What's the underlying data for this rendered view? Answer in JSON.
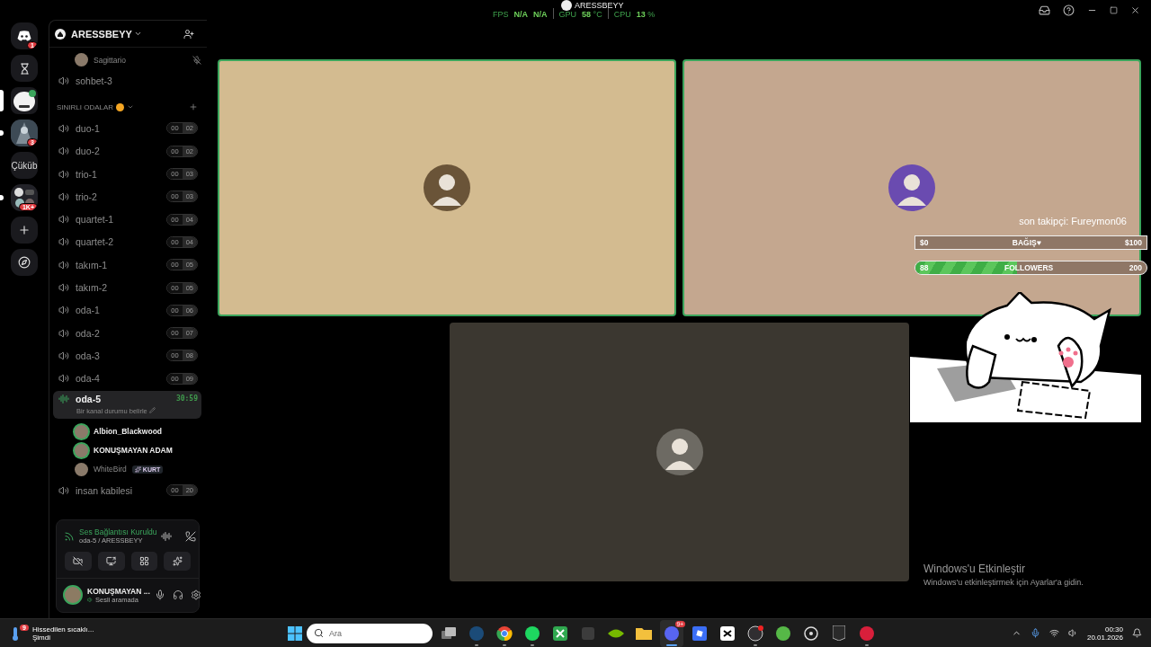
{
  "top_overlay": {
    "user": "ARESSBEYY",
    "fps_label": "FPS",
    "fps_value": "N/A",
    "fps_value_2": "N/A",
    "gpu_label": "GPU",
    "gpu_value": "58",
    "gpu_unit": "°C",
    "cpu_label": "CPU",
    "cpu_value": "13",
    "cpu_unit": "%"
  },
  "servers": [
    {
      "kind": "discord",
      "badge": "1",
      "selected": false,
      "unread": false
    },
    {
      "kind": "hourglass",
      "selected": false,
      "unread": false
    },
    {
      "kind": "mascot",
      "selected": true,
      "unread": false
    },
    {
      "kind": "game",
      "badge": "3",
      "selected": false,
      "unread": true
    },
    {
      "kind": "text",
      "label": "Çüküb",
      "selected": false,
      "unread": false
    },
    {
      "kind": "folder",
      "badge": "1K+",
      "selected": false,
      "unread": true
    },
    {
      "kind": "add",
      "selected": false,
      "unread": false
    },
    {
      "kind": "explore",
      "selected": false,
      "unread": false
    }
  ],
  "server_header": {
    "name": "ARESSBEYY"
  },
  "channel_list": [
    {
      "kind": "member",
      "name": "Sagittario",
      "speaking": false,
      "muted_icon": true
    },
    {
      "kind": "channel",
      "name": "sohbet-3",
      "selected": false
    },
    {
      "kind": "category",
      "name": "SINIRLI ODALAR"
    },
    {
      "kind": "channel",
      "name": "duo-1",
      "users": "00",
      "limit": "02",
      "selected": false
    },
    {
      "kind": "channel",
      "name": "duo-2",
      "users": "00",
      "limit": "02",
      "selected": false
    },
    {
      "kind": "channel",
      "name": "trio-1",
      "users": "00",
      "limit": "03",
      "selected": false
    },
    {
      "kind": "channel",
      "name": "trio-2",
      "users": "00",
      "limit": "03",
      "selected": false
    },
    {
      "kind": "channel",
      "name": "quartet-1",
      "users": "00",
      "limit": "04",
      "selected": false
    },
    {
      "kind": "channel",
      "name": "quartet-2",
      "users": "00",
      "limit": "04",
      "selected": false
    },
    {
      "kind": "channel",
      "name": "takım-1",
      "users": "00",
      "limit": "05",
      "selected": false
    },
    {
      "kind": "channel",
      "name": "takım-2",
      "users": "00",
      "limit": "05",
      "selected": false
    },
    {
      "kind": "channel",
      "name": "oda-1",
      "users": "00",
      "limit": "06",
      "selected": false
    },
    {
      "kind": "channel",
      "name": "oda-2",
      "users": "00",
      "limit": "07",
      "selected": false
    },
    {
      "kind": "channel",
      "name": "oda-3",
      "users": "00",
      "limit": "08",
      "selected": false
    },
    {
      "kind": "channel",
      "name": "oda-4",
      "users": "00",
      "limit": "09",
      "selected": false
    },
    {
      "kind": "channel",
      "name": "oda-5",
      "timer": "30:59",
      "status": "Bir kanal durumu belirle",
      "selected": true
    },
    {
      "kind": "member",
      "name": "Albion_Blackwood",
      "speaking": true
    },
    {
      "kind": "member",
      "name": "KONUŞMAYAN ADAM",
      "speaking": true
    },
    {
      "kind": "member",
      "name": "WhiteBird",
      "speaking": false,
      "tag": "KURT"
    },
    {
      "kind": "channel",
      "name": "insan kabilesi",
      "users": "00",
      "limit": "20",
      "selected": false
    }
  ],
  "voice_panel": {
    "status": "Ses Bağlantısı Kuruldu",
    "location": "oda-5 / ARESSBEYY"
  },
  "user_panel": {
    "name": "KONUŞMAYAN ...",
    "status": "Sesli aramada"
  },
  "tiles": [
    {
      "speaking": true,
      "color": "#d3bb90"
    },
    {
      "speaking": true,
      "color": "#c4a78f"
    },
    {
      "speaking": false,
      "color": "#3b3730"
    }
  ],
  "stream_overlay": {
    "last_follower": "son takipçi: Fureymon06",
    "donation": {
      "min": "$0",
      "label": "BAĞIŞ♥",
      "max": "$100",
      "level": 0
    },
    "followers": {
      "current": "88",
      "label": "FOLLOWERS",
      "goal": "200",
      "level": 0.44
    }
  },
  "activation": {
    "title": "Windows'u Etkinleştir",
    "text": "Windows'u etkinleştirmek için Ayarlar'a gidin."
  },
  "taskbar": {
    "weather": {
      "badge": "9",
      "text": "Hissedilen sıcaklı...",
      "time": "Şimdi"
    },
    "search_placeholder": "Ara",
    "apps": [
      {
        "kind": "taskview",
        "running": false,
        "selected": false
      },
      {
        "kind": "steam",
        "running": true,
        "selected": false
      },
      {
        "kind": "chrome",
        "running": true,
        "selected": false
      },
      {
        "kind": "spotify",
        "running": true,
        "selected": false
      },
      {
        "kind": "xbox",
        "running": false,
        "selected": false
      },
      {
        "kind": "blank",
        "running": false,
        "selected": false
      },
      {
        "kind": "nvidia",
        "running": false,
        "selected": false
      },
      {
        "kind": "folder",
        "running": false,
        "selected": false
      },
      {
        "kind": "discord",
        "badge": "9+",
        "running": true,
        "selected": true
      },
      {
        "kind": "roblox",
        "running": false,
        "selected": false
      },
      {
        "kind": "capcut",
        "running": false,
        "selected": false
      },
      {
        "kind": "obs",
        "running": true,
        "selected": false
      },
      {
        "kind": "torrent",
        "running": false,
        "selected": false
      },
      {
        "kind": "target",
        "running": false,
        "selected": false
      },
      {
        "kind": "epic",
        "running": false,
        "selected": false
      },
      {
        "kind": "red",
        "running": true,
        "selected": false
      }
    ],
    "clock": {
      "time": "00:30",
      "date": "20.01.2026"
    }
  }
}
